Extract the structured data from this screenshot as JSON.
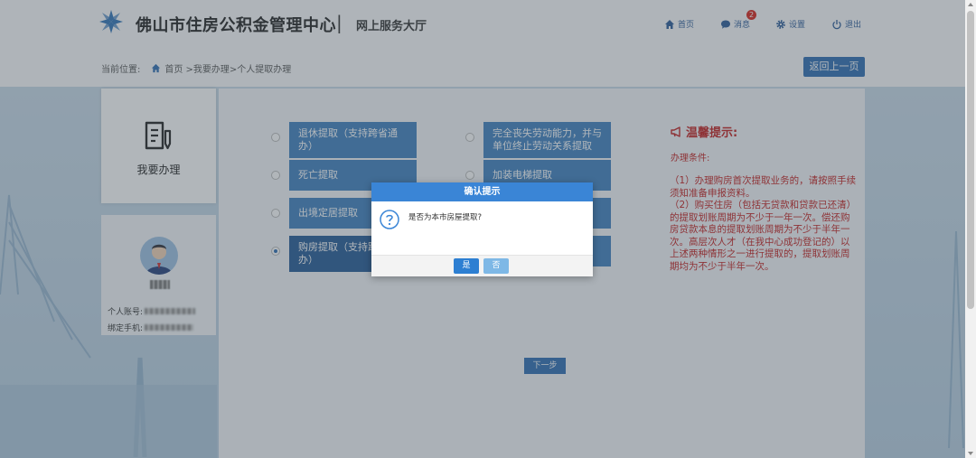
{
  "header": {
    "title": "佛山市住房公积金管理中心",
    "separator": "|",
    "subtitle": "网上服务大厅",
    "nav": [
      {
        "label": "首页",
        "icon": "home-icon"
      },
      {
        "label": "消息",
        "icon": "message-icon",
        "badge": "2"
      },
      {
        "label": "设置",
        "icon": "gear-icon"
      },
      {
        "label": "退出",
        "icon": "power-icon"
      }
    ]
  },
  "breadcrumb": {
    "prefix": "当前位置:",
    "path": "首页 >我要办理>个人提取办理"
  },
  "back_button": "返回上一页",
  "sidebar": {
    "card_label": "我要办理",
    "account_label": "个人账号:",
    "phone_label": "绑定手机:"
  },
  "options": [
    {
      "label": "退休提取（支持跨省通办）",
      "selected": false
    },
    {
      "label": "完全丧失劳动能力，并与单位终止劳动关系提取",
      "selected": false
    },
    {
      "label": "死亡提取",
      "selected": false
    },
    {
      "label": "加装电梯提取",
      "selected": false
    },
    {
      "label": "出境定居提取",
      "selected": false
    },
    {
      "label": "",
      "selected": false
    },
    {
      "label": "购房提取（支持跨省通办）",
      "selected": true
    },
    {
      "label": "",
      "selected": false
    }
  ],
  "next_button": "下一步",
  "tips": {
    "title": "温馨提示:",
    "condition_label": "办理条件:",
    "item1": "（1）办理购房首次提取业务的，请按照手续须知准备申报资料。",
    "item2": "（2）购买住房（包括无贷款和贷款已还清）的提取划账周期为不少于一年一次。偿还购房贷款本息的提取划账周期为不少于半年一次。高层次人才（在我中心成功登记的）以上述两种情形之一进行提取的，提取划账周期均为不少于半年一次。"
  },
  "dialog": {
    "title": "确认提示",
    "message": "是否为本市房屋提取?",
    "yes": "是",
    "no": "否"
  },
  "colors": {
    "primary": "#2d6db3",
    "option": "#3e80c0",
    "tips_red": "#c31d1d",
    "dialog_header": "#3a85d6"
  }
}
